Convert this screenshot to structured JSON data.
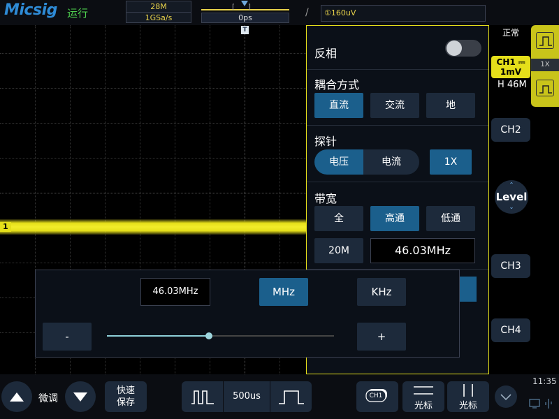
{
  "header": {
    "brand": "Micsig",
    "run_state": "运行",
    "memory_depth": "28M",
    "sample_rate": "1GSa/s",
    "trigger_position": "0ps",
    "trigger_slope_symbol": "/",
    "trigger_level": "①160uV",
    "trigger_status": "正常"
  },
  "waveform": {
    "channel_marker": "1",
    "trigger_marker": "T"
  },
  "panel": {
    "invert": {
      "label": "反相",
      "on": false
    },
    "coupling": {
      "label": "耦合方式",
      "options": [
        "直流",
        "交流",
        "地"
      ],
      "selected": "直流"
    },
    "probe": {
      "label": "探针",
      "type_options": [
        "电压",
        "电流"
      ],
      "selected_type": "电压",
      "attenuation": "1X"
    },
    "bandwidth": {
      "label": "带宽",
      "options": [
        "全",
        "高通",
        "低通"
      ],
      "selected": "高通",
      "preset": "20M",
      "value": "46.03MHz"
    }
  },
  "keypad": {
    "value": "46.03MHz",
    "units": [
      "MHz",
      "KHz"
    ],
    "selected_unit": "MHz",
    "minus": "-",
    "plus": "+",
    "slider_fraction": 0.45
  },
  "right_rail": {
    "ch1_badge_line1": "CH1 ⎓",
    "ch1_badge_line2": "1mV",
    "bandwidth_limit": "H 46M",
    "ch2": "CH2",
    "ch3": "CH3",
    "ch4": "CH4",
    "level": "Level",
    "ch1_tab_probe": "1X"
  },
  "bottom": {
    "fine_label": "微调",
    "quick_save_line1": "快速",
    "quick_save_line2": "保存",
    "timebase": "500us",
    "ch1_icon_label": "CH1",
    "cursor_h_label": "光标",
    "cursor_v_label": "光标",
    "clock": "11:35"
  },
  "colors": {
    "channel1": "#e5df1a",
    "accent_blue": "#1b5f8c",
    "button_bg": "#1d2a3b",
    "run_green": "#4fd14f"
  }
}
